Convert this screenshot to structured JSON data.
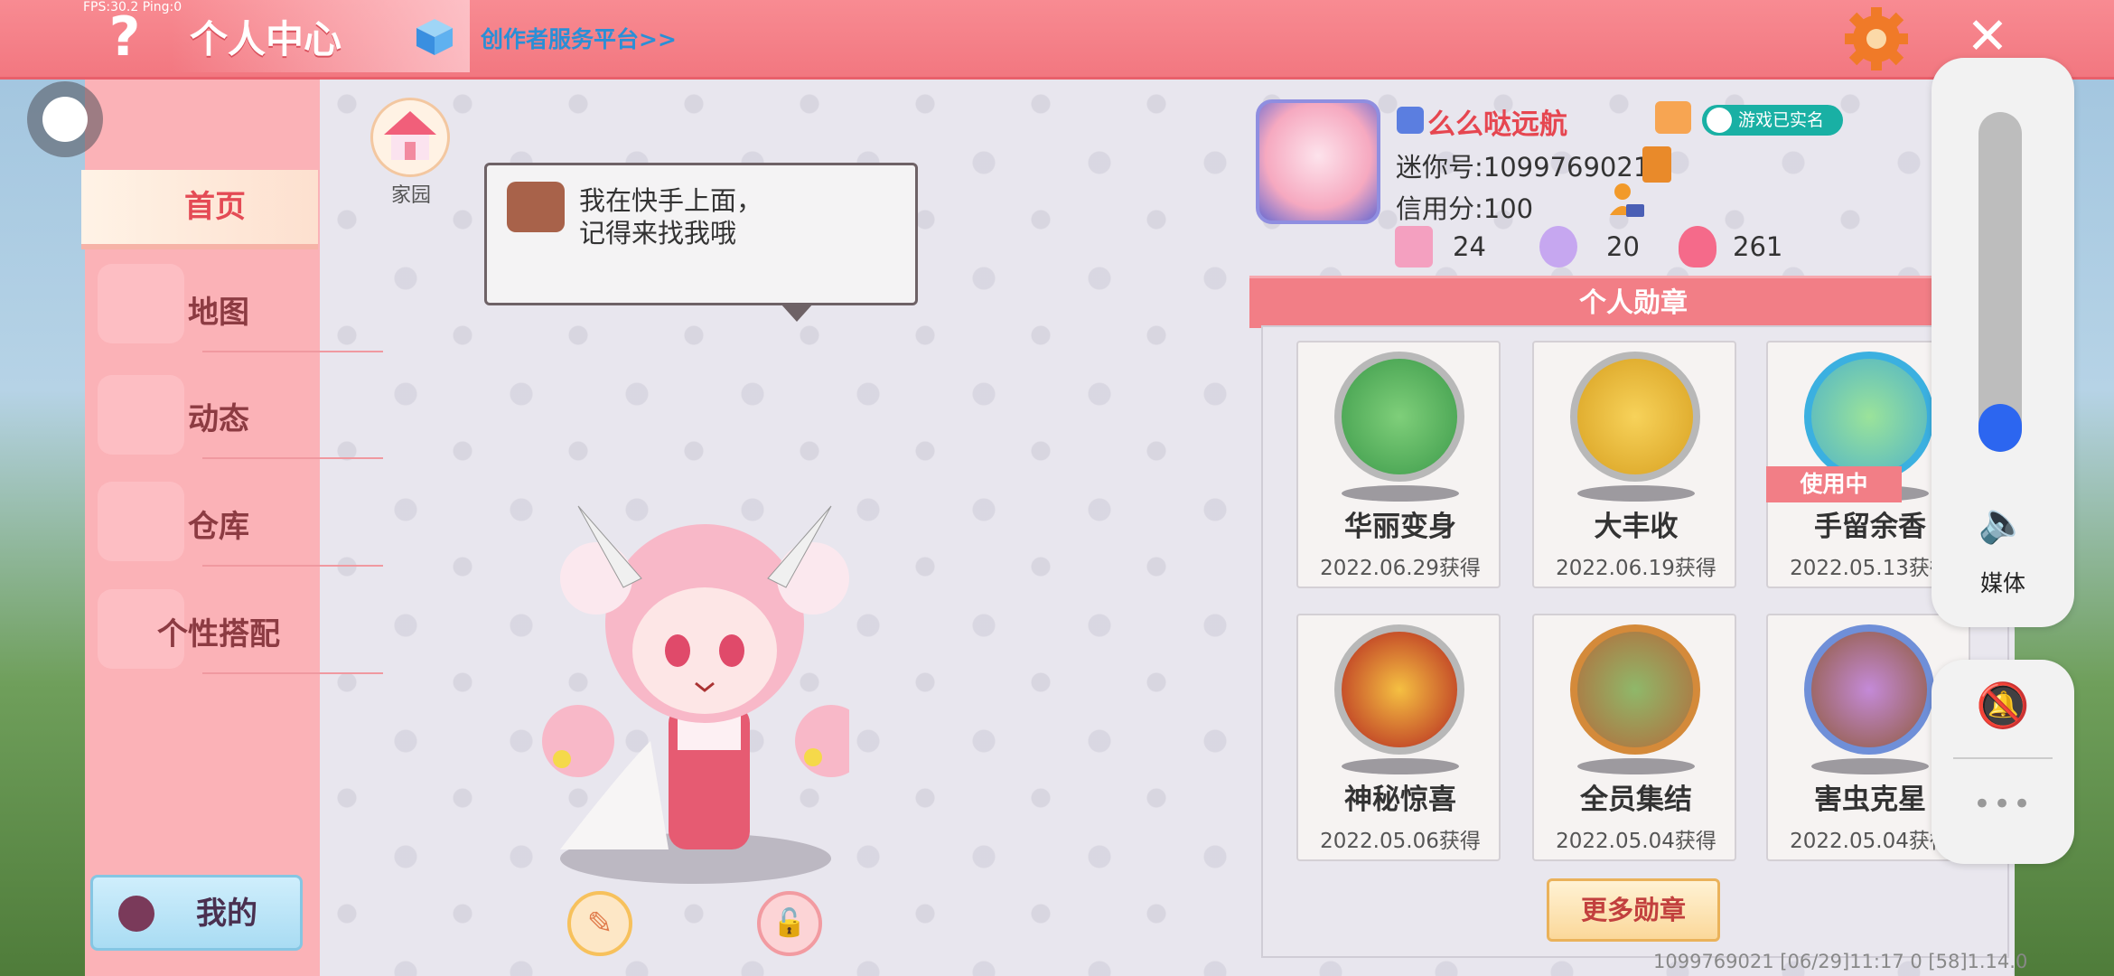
{
  "debug": {
    "fps_text": "FPS:30.2  Ping:0"
  },
  "header": {
    "title": "个人中心",
    "creator_link": "创作者服务平台>>",
    "help_icon": "question-icon",
    "settings_icon": "gear-icon",
    "close_icon": "close-icon"
  },
  "sidebar": {
    "items": [
      {
        "label": "首页",
        "active": true
      },
      {
        "label": "地图"
      },
      {
        "label": "动态"
      },
      {
        "label": "仓库"
      },
      {
        "label": "个性搭配"
      }
    ],
    "mine_label": "我的"
  },
  "home": {
    "label": "家园"
  },
  "bubble": {
    "line1": "我在快手上面，",
    "line2": "记得来找我哦"
  },
  "profile": {
    "username": "么么哒远航",
    "realname_badge": "游戏已实名",
    "mini_id": "迷你号:1099769021",
    "credit": "信用分:100",
    "stats": [
      {
        "icon": "plus-bookmark-icon",
        "value": "24"
      },
      {
        "icon": "cheer-icon",
        "value": "20"
      },
      {
        "icon": "flame-icon",
        "value": "261"
      }
    ]
  },
  "medals": {
    "title": "个人勋章",
    "items": [
      {
        "name": "华丽变身",
        "date": "2022.06.29获得"
      },
      {
        "name": "大丰收",
        "date": "2022.06.19获得"
      },
      {
        "name": "手留余香",
        "date": "2022.05.13获得",
        "status": "使用中"
      },
      {
        "name": "神秘惊喜",
        "date": "2022.05.06获得"
      },
      {
        "name": "全员集结",
        "date": "2022.05.04获得"
      },
      {
        "name": "害虫克星",
        "date": "2022.05.04获得"
      }
    ],
    "more_label": "更多勋章"
  },
  "system_volume": {
    "label": "媒体",
    "level": 0.14,
    "fill_color": "#2c66f0"
  },
  "footer": {
    "info": "1099769021    [06/29]11:17 0   [58]1.14.0"
  },
  "colors": {
    "accent": "#f27780",
    "username": "#e64650",
    "realname": "#19b0a4"
  }
}
